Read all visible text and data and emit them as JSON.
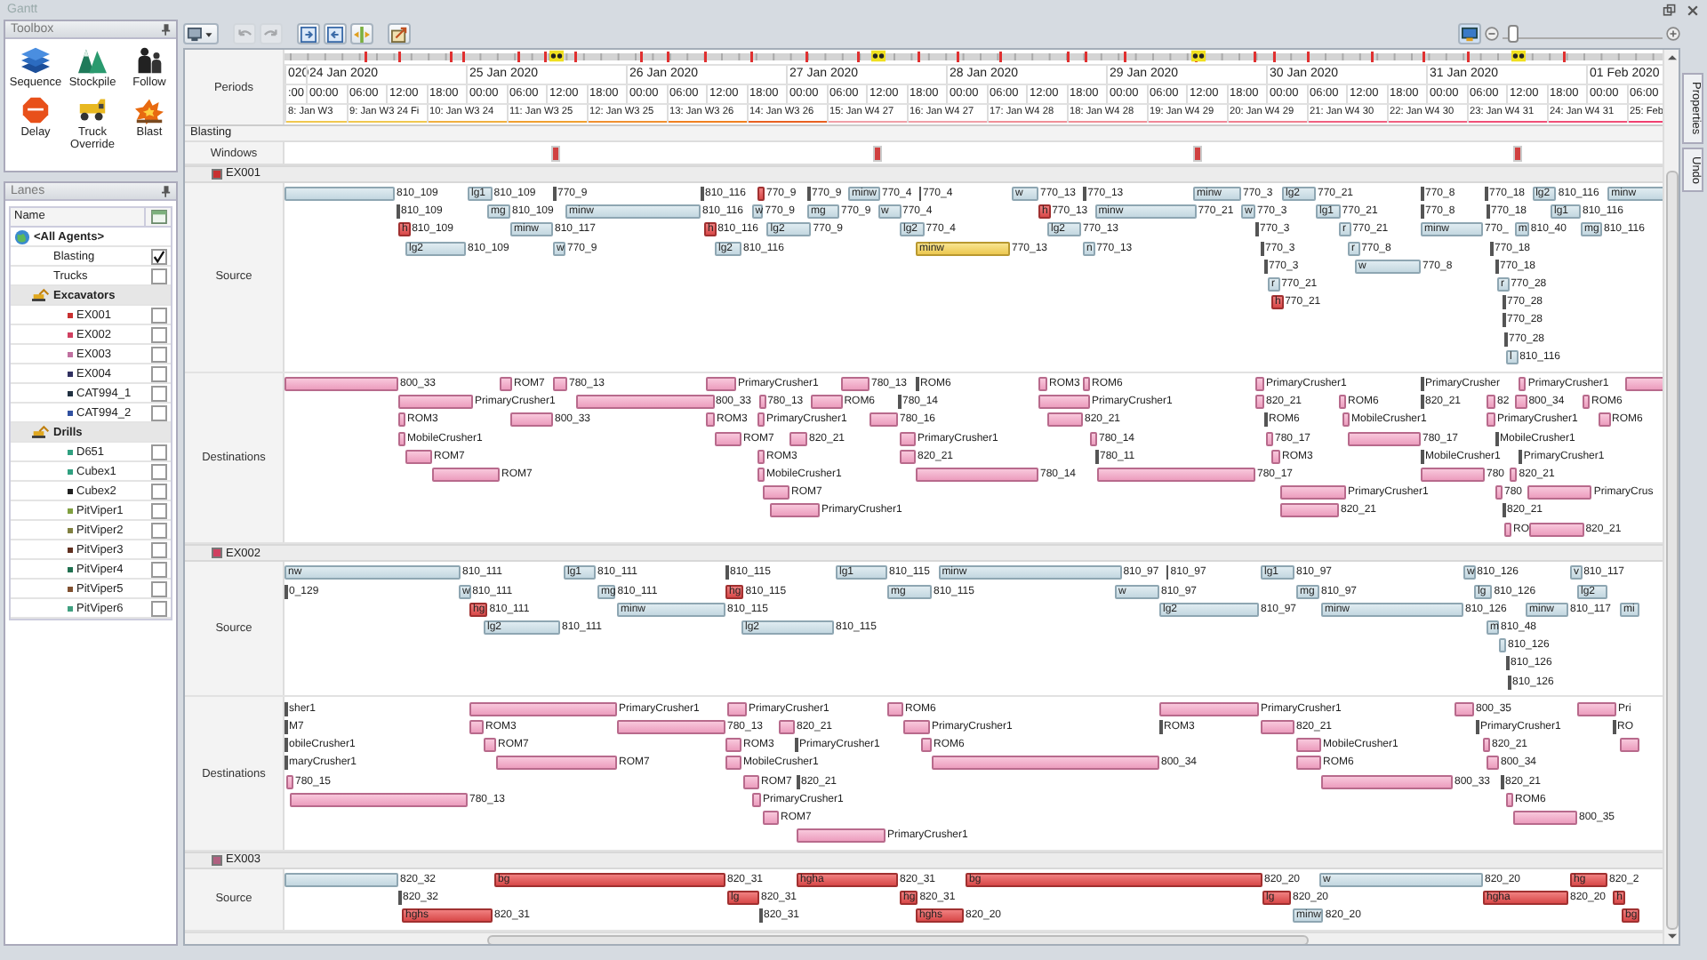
{
  "window": {
    "title": "Gantt"
  },
  "toolbox": {
    "title": "Toolbox",
    "tools": [
      {
        "label": "Sequence",
        "kind": "layers"
      },
      {
        "label": "Stockpile",
        "kind": "stockpile"
      },
      {
        "label": "Follow",
        "kind": "people"
      },
      {
        "label": "Delay",
        "kind": "stop"
      },
      {
        "label": "Truck Override",
        "kind": "truck"
      },
      {
        "label": "Blast",
        "kind": "blast"
      }
    ]
  },
  "lanes": {
    "title": "Lanes",
    "column": "Name",
    "items": [
      {
        "name": "<All Agents>",
        "kind": "root",
        "children": [
          {
            "name": "Blasting",
            "kind": "lane",
            "checked": true
          },
          {
            "name": "Trucks",
            "kind": "lane",
            "checked": false
          },
          {
            "name": "Excavators",
            "kind": "group",
            "children": [
              {
                "name": "EX001",
                "kind": "agent",
                "color": "#c83030",
                "checked": false
              },
              {
                "name": "EX002",
                "kind": "agent",
                "color": "#d04060",
                "checked": false
              },
              {
                "name": "EX003",
                "kind": "agent",
                "color": "#c070a0",
                "checked": false
              },
              {
                "name": "EX004",
                "kind": "agent",
                "color": "#303060",
                "checked": false
              },
              {
                "name": "CAT994_1",
                "kind": "agent",
                "color": "#203040",
                "checked": false
              },
              {
                "name": "CAT994_2",
                "kind": "agent",
                "color": "#3050a0",
                "checked": false
              }
            ]
          },
          {
            "name": "Drills",
            "kind": "group",
            "children": [
              {
                "name": "D651",
                "kind": "agent",
                "color": "#30a080",
                "checked": false
              },
              {
                "name": "Cubex1",
                "kind": "agent",
                "color": "#30a080",
                "checked": false
              },
              {
                "name": "Cubex2",
                "kind": "agent",
                "color": "#202020",
                "checked": false
              },
              {
                "name": "PitViper1",
                "kind": "agent",
                "color": "#80a040",
                "checked": false
              },
              {
                "name": "PitViper2",
                "kind": "agent",
                "color": "#808040",
                "checked": false
              },
              {
                "name": "PitViper3",
                "kind": "agent",
                "color": "#603020",
                "checked": false
              },
              {
                "name": "PitViper4",
                "kind": "agent",
                "color": "#207050",
                "checked": false
              },
              {
                "name": "PitViper5",
                "kind": "agent",
                "color": "#805030",
                "checked": false
              },
              {
                "name": "PitViper6",
                "kind": "agent",
                "color": "#40a080",
                "checked": false
              }
            ]
          }
        ]
      }
    ]
  },
  "toolbar": {
    "buttons": [
      {
        "kind": "view-menu",
        "disabled": false
      },
      {
        "kind": "undo",
        "disabled": true
      },
      {
        "kind": "redo",
        "disabled": true
      },
      {
        "kind": "expand",
        "disabled": false
      },
      {
        "kind": "collapse",
        "disabled": false
      },
      {
        "kind": "fit",
        "disabled": false
      },
      {
        "kind": "export",
        "disabled": false
      }
    ],
    "zoom": {
      "level": 0.03
    }
  },
  "timeline": {
    "label": "Periods",
    "dates": [
      "020",
      "24 Jan 2020",
      "25 Jan 2020",
      "26 Jan 2020",
      "27 Jan 2020",
      "28 Jan 2020",
      "29 Jan 2020",
      "30 Jan 2020",
      "31 Jan 2020",
      "01 Feb 2020"
    ],
    "hours": [
      ":00",
      "00:00",
      "06:00",
      "12:00",
      "18:00",
      "00:00",
      "06:00",
      "12:00",
      "18:00",
      "00:00",
      "06:00",
      "12:00",
      "18:00",
      "00:00",
      "06:00",
      "12:00",
      "18:00",
      "00:00",
      "06:00",
      "12:00",
      "18:00",
      "00:00",
      "06:00",
      "12:00",
      "18:00",
      "00:00",
      "06:00",
      "12:00",
      "18:00",
      "00:00",
      "06:00",
      "12:00",
      "18:00",
      "00:00",
      "06:00"
    ],
    "shifts": [
      {
        "label": "8: Jan W3",
        "color": "#f0c850"
      },
      {
        "label": "9: Jan W3 24 Fi",
        "color": "#f0c850"
      },
      {
        "label": "10: Jan W3 24",
        "color": "#f0b040"
      },
      {
        "label": "11: Jan W3 25",
        "color": "#f0a030"
      },
      {
        "label": "12: Jan W3 25",
        "color": "#f09030"
      },
      {
        "label": "13: Jan W3 26",
        "color": "#f08020"
      },
      {
        "label": "14: Jan W3 26",
        "color": "#e86020"
      },
      {
        "label": "15: Jan W4 27",
        "color": "#f0a0a8"
      },
      {
        "label": "16: Jan W4 27",
        "color": "#f0a0a8"
      },
      {
        "label": "17: Jan W4 28",
        "color": "#f09098"
      },
      {
        "label": "18: Jan W4 28",
        "color": "#f09098"
      },
      {
        "label": "19: Jan W4 29",
        "color": "#f08898"
      },
      {
        "label": "20: Jan W4 29",
        "color": "#f08090"
      },
      {
        "label": "21: Jan W4 30",
        "color": "#f06080"
      },
      {
        "label": "22: Jan W4 30",
        "color": "#f06080"
      },
      {
        "label": "23: Jan W4 31",
        "color": "#f05078"
      },
      {
        "label": "24: Jan W4 31",
        "color": "#f05078"
      },
      {
        "label": "25: Feb",
        "color": "#f04070"
      }
    ]
  },
  "blasting": {
    "title": "Blasting",
    "label": "Windows"
  },
  "groups": [
    {
      "name": "EX001",
      "color": "#c83030",
      "lanes": [
        {
          "label": "Source",
          "rows": [
            {
              "tasks": [
                {
                  "kind": "waste",
                  "label": "810_109"
                },
                {
                  "code": "lg1",
                  "kind": "waste",
                  "label": "810_109"
                },
                {
                  "kind": "tick",
                  "label": "770_9"
                },
                {
                  "kind": "tick",
                  "label": "810_116"
                },
                {
                  "kind": "high",
                  "label": "770_9"
                },
                {
                  "kind": "tick",
                  "label": "770_9"
                },
                {
                  "code": "minw",
                  "kind": "waste",
                  "label": "770_4"
                },
                {
                  "kind": "tick",
                  "label": "770_4"
                },
                {
                  "code": "w",
                  "kind": "waste",
                  "label": "770_13"
                },
                {
                  "kind": "tick",
                  "label": "770_13"
                },
                {
                  "code": "minw",
                  "kind": "waste",
                  "label": "770_3"
                },
                {
                  "code": "lg2",
                  "kind": "waste",
                  "label": "770_21"
                },
                {
                  "kind": "tick",
                  "label": "770_8"
                },
                {
                  "kind": "tick",
                  "label": "770_18"
                },
                {
                  "code": "lg2",
                  "kind": "waste",
                  "label": "810_116"
                },
                {
                  "code": "minw",
                  "kind": "waste"
                }
              ]
            },
            {
              "tasks": [
                {
                  "kind": "tick",
                  "label": "810_109"
                },
                {
                  "code": "mg",
                  "kind": "waste",
                  "label": "810_109"
                },
                {
                  "code": "minw",
                  "kind": "waste",
                  "label": "810_116"
                },
                {
                  "code": "w",
                  "kind": "waste",
                  "label": "770_9"
                },
                {
                  "code": "mg",
                  "kind": "waste",
                  "label": "770_9"
                },
                {
                  "code": "w",
                  "kind": "waste",
                  "label": "770_4"
                },
                {
                  "code": "h",
                  "kind": "high",
                  "label": "770_13"
                },
                {
                  "code": "minw",
                  "kind": "waste",
                  "label": "770_21"
                },
                {
                  "code": "w",
                  "kind": "waste",
                  "label": "770_3"
                },
                {
                  "code": "lg1",
                  "kind": "waste",
                  "label": "770_21"
                },
                {
                  "kind": "tick",
                  "label": "770_8"
                },
                {
                  "kind": "tick",
                  "label": "770_18"
                },
                {
                  "code": "lg1",
                  "kind": "waste",
                  "label": "810_116"
                }
              ]
            },
            {
              "tasks": [
                {
                  "code": "h",
                  "kind": "high",
                  "label": "810_109"
                },
                {
                  "code": "minw",
                  "kind": "waste",
                  "label": "810_117"
                },
                {
                  "code": "h",
                  "kind": "high",
                  "label": "810_116"
                },
                {
                  "code": "lg2",
                  "kind": "waste",
                  "label": "770_9"
                },
                {
                  "code": "lg2",
                  "kind": "waste",
                  "label": "770_4"
                },
                {
                  "code": "lg2",
                  "kind": "waste",
                  "label": "770_13"
                },
                {
                  "kind": "tick",
                  "label": "770_3"
                },
                {
                  "code": "r",
                  "kind": "waste",
                  "label": "770_21"
                },
                {
                  "code": "minw",
                  "kind": "waste",
                  "label": "770_"
                },
                {
                  "code": "m",
                  "kind": "waste",
                  "label": "810_40"
                },
                {
                  "code": "mg",
                  "kind": "waste",
                  "label": "810_116"
                }
              ]
            },
            {
              "tasks": [
                {
                  "code": "lg2",
                  "kind": "waste",
                  "label": "810_109"
                },
                {
                  "code": "w",
                  "kind": "waste",
                  "label": "770_9"
                },
                {
                  "code": "lg2",
                  "kind": "waste",
                  "label": "810_116"
                },
                {
                  "code": "minw",
                  "kind": "flagged",
                  "label": "770_13"
                },
                {
                  "code": "n",
                  "kind": "waste",
                  "label": "770_13"
                },
                {
                  "kind": "tick",
                  "label": "770_3"
                },
                {
                  "code": "r",
                  "kind": "waste",
                  "label": "770_8"
                },
                {
                  "kind": "tick",
                  "label": "770_18"
                }
              ]
            },
            {
              "tasks": [
                {
                  "kind": "tick",
                  "label": "770_3"
                },
                {
                  "code": "w",
                  "kind": "waste",
                  "label": "770_8"
                },
                {
                  "kind": "tick",
                  "label": "770_18"
                }
              ]
            },
            {
              "tasks": [
                {
                  "code": "r",
                  "kind": "waste",
                  "label": "770_21"
                },
                {
                  "code": "r",
                  "kind": "waste",
                  "label": "770_28"
                }
              ]
            },
            {
              "tasks": [
                {
                  "code": "h",
                  "kind": "high",
                  "label": "770_21"
                },
                {
                  "kind": "tick",
                  "label": "770_28"
                }
              ]
            },
            {
              "tasks": [
                {
                  "kind": "tick",
                  "label": "770_28"
                }
              ]
            },
            {
              "tasks": [
                {
                  "kind": "tick",
                  "label": "770_28"
                }
              ]
            },
            {
              "tasks": [
                {
                  "code": "l",
                  "kind": "waste",
                  "label": "810_116"
                }
              ]
            }
          ]
        },
        {
          "label": "Destinations",
          "rows": [
            {
              "tasks": [
                {
                  "kind": "ore",
                  "label": "800_33"
                },
                {
                  "kind": "ore",
                  "label": "ROM7"
                },
                {
                  "kind": "ore",
                  "label": "780_13"
                },
                {
                  "kind": "ore",
                  "label": "PrimaryCrusher1"
                },
                {
                  "kind": "ore",
                  "label": "780_13"
                },
                {
                  "kind": "tick",
                  "label": "ROM6"
                },
                {
                  "kind": "ore",
                  "label": "ROM3"
                },
                {
                  "kind": "ore",
                  "label": "ROM6"
                },
                {
                  "kind": "ore",
                  "label": "PrimaryCrusher1"
                },
                {
                  "kind": "tick",
                  "label": "PrimaryCrusher"
                },
                {
                  "kind": "ore",
                  "label": "PrimaryCrusher1"
                },
                {
                  "kind": "ore"
                }
              ]
            },
            {
              "tasks": [
                {
                  "kind": "ore",
                  "label": "PrimaryCrusher1"
                },
                {
                  "kind": "ore",
                  "label": "800_33"
                },
                {
                  "kind": "ore",
                  "label": "780_13"
                },
                {
                  "kind": "ore",
                  "label": "ROM6"
                },
                {
                  "kind": "tick",
                  "label": "780_14"
                },
                {
                  "kind": "ore",
                  "label": "PrimaryCrusher1"
                },
                {
                  "kind": "ore",
                  "label": "820_21"
                },
                {
                  "kind": "ore",
                  "label": "ROM6"
                },
                {
                  "kind": "tick",
                  "label": "820_21"
                },
                {
                  "kind": "ore",
                  "label": "82"
                },
                {
                  "kind": "ore",
                  "label": "800_34"
                },
                {
                  "kind": "ore",
                  "label": "ROM6"
                }
              ]
            },
            {
              "tasks": [
                {
                  "kind": "ore",
                  "label": "ROM3"
                },
                {
                  "kind": "ore",
                  "label": "800_33"
                },
                {
                  "kind": "ore",
                  "label": "ROM3"
                },
                {
                  "kind": "ore",
                  "label": "PrimaryCrusher1"
                },
                {
                  "kind": "ore",
                  "label": "780_16"
                },
                {
                  "kind": "ore",
                  "label": "820_21"
                },
                {
                  "kind": "tick",
                  "label": "ROM6"
                },
                {
                  "kind": "ore",
                  "label": "MobileCrusher1"
                },
                {
                  "kind": "ore",
                  "label": "PrimaryCrusher1"
                },
                {
                  "kind": "ore",
                  "label": "ROM6"
                }
              ]
            },
            {
              "tasks": [
                {
                  "kind": "ore",
                  "label": "MobileCrusher1"
                },
                {
                  "kind": "ore",
                  "label": "ROM7"
                },
                {
                  "kind": "ore",
                  "label": "820_21"
                },
                {
                  "kind": "ore",
                  "label": "PrimaryCrusher1"
                },
                {
                  "kind": "ore",
                  "label": "780_14"
                },
                {
                  "kind": "ore",
                  "label": "780_17"
                },
                {
                  "kind": "ore",
                  "label": "780_17"
                },
                {
                  "kind": "tick",
                  "label": "MobileCrusher1"
                }
              ]
            },
            {
              "tasks": [
                {
                  "kind": "ore",
                  "label": "ROM7"
                },
                {
                  "kind": "ore",
                  "label": "ROM3"
                },
                {
                  "kind": "ore",
                  "label": "820_21"
                },
                {
                  "kind": "tick",
                  "label": "780_11"
                },
                {
                  "kind": "ore",
                  "label": "ROM3"
                },
                {
                  "kind": "tick",
                  "label": "MobileCrusher1"
                },
                {
                  "kind": "tick",
                  "label": "PrimaryCrusher1"
                }
              ]
            },
            {
              "tasks": [
                {
                  "kind": "ore",
                  "label": "ROM7"
                },
                {
                  "kind": "ore",
                  "label": "MobileCrusher1"
                },
                {
                  "kind": "ore",
                  "label": "780_14"
                },
                {
                  "kind": "ore",
                  "label": "780_17"
                },
                {
                  "kind": "ore",
                  "label": "780"
                },
                {
                  "kind": "ore",
                  "label": "820_21"
                }
              ]
            },
            {
              "tasks": [
                {
                  "kind": "ore",
                  "label": "ROM7"
                },
                {
                  "kind": "ore",
                  "label": "PrimaryCrusher1"
                },
                {
                  "kind": "ore",
                  "label": "780"
                },
                {
                  "kind": "ore",
                  "label": "PrimaryCrus"
                }
              ]
            },
            {
              "tasks": [
                {
                  "kind": "ore",
                  "label": "PrimaryCrusher1"
                },
                {
                  "kind": "ore",
                  "label": "820_21"
                },
                {
                  "kind": "tick",
                  "label": "820_21"
                }
              ]
            },
            {
              "tasks": [
                {
                  "kind": "ore",
                  "label": "RO"
                },
                {
                  "kind": "ore",
                  "label": "820_21"
                }
              ]
            }
          ]
        }
      ]
    },
    {
      "name": "EX002",
      "color": "#d04060",
      "lanes": [
        {
          "label": "Source",
          "rows": [
            {
              "tasks": [
                {
                  "code": "nw",
                  "kind": "waste",
                  "label": "810_111"
                },
                {
                  "code": "lg1",
                  "kind": "waste",
                  "label": "810_111"
                },
                {
                  "kind": "tick",
                  "label": "810_115"
                },
                {
                  "code": "lg1",
                  "kind": "waste",
                  "label": "810_115"
                },
                {
                  "code": "minw",
                  "kind": "waste",
                  "label": "810_97"
                },
                {
                  "kind": "tick",
                  "label": "810_97"
                },
                {
                  "code": "lg1",
                  "kind": "waste",
                  "label": "810_97"
                },
                {
                  "code": "w",
                  "kind": "waste",
                  "label": "810_126"
                },
                {
                  "code": "v",
                  "kind": "waste",
                  "label": "810_117"
                }
              ]
            },
            {
              "tasks": [
                {
                  "kind": "tick",
                  "label": "0_129"
                },
                {
                  "code": "w",
                  "kind": "waste",
                  "label": "810_111"
                },
                {
                  "code": "mg",
                  "kind": "waste",
                  "label": "810_111"
                },
                {
                  "code": "hg",
                  "kind": "high",
                  "label": "810_115"
                },
                {
                  "code": "mg",
                  "kind": "waste",
                  "label": "810_115"
                },
                {
                  "code": "w",
                  "kind": "waste",
                  "label": "810_97"
                },
                {
                  "code": "mg",
                  "kind": "waste",
                  "label": "810_97"
                },
                {
                  "code": "lg",
                  "kind": "waste",
                  "label": "810_126"
                },
                {
                  "code": "lg2",
                  "kind": "waste"
                }
              ]
            },
            {
              "tasks": [
                {
                  "code": "hg",
                  "kind": "high",
                  "label": "810_111"
                },
                {
                  "code": "minw",
                  "kind": "waste",
                  "label": "810_115"
                },
                {
                  "code": "lg2",
                  "kind": "waste",
                  "label": "810_97"
                },
                {
                  "code": "minw",
                  "kind": "waste",
                  "label": "810_126"
                },
                {
                  "code": "minw",
                  "kind": "waste",
                  "label": "810_117"
                },
                {
                  "code": "mi",
                  "kind": "waste"
                }
              ]
            },
            {
              "tasks": [
                {
                  "code": "lg2",
                  "kind": "waste",
                  "label": "810_111"
                },
                {
                  "code": "lg2",
                  "kind": "waste",
                  "label": "810_115"
                },
                {
                  "code": "m",
                  "kind": "waste",
                  "label": "810_48"
                }
              ]
            },
            {
              "tasks": [
                {
                  "kind": "waste",
                  "label": "810_126"
                }
              ]
            },
            {
              "tasks": [
                {
                  "kind": "tick",
                  "label": "810_126"
                }
              ]
            },
            {
              "tasks": [
                {
                  "kind": "tick",
                  "label": "810_126"
                }
              ]
            }
          ]
        },
        {
          "label": "Destinations",
          "rows": [
            {
              "tasks": [
                {
                  "kind": "tick",
                  "label": "sher1"
                },
                {
                  "kind": "ore",
                  "label": "PrimaryCrusher1"
                },
                {
                  "kind": "ore",
                  "label": "PrimaryCrusher1"
                },
                {
                  "kind": "ore",
                  "label": "ROM6"
                },
                {
                  "kind": "ore",
                  "label": "PrimaryCrusher1"
                },
                {
                  "kind": "ore",
                  "label": "800_35"
                },
                {
                  "kind": "ore",
                  "label": "Pri"
                }
              ]
            },
            {
              "tasks": [
                {
                  "kind": "tick",
                  "label": "M7"
                },
                {
                  "kind": "ore",
                  "label": "ROM3"
                },
                {
                  "kind": "ore",
                  "label": "780_13"
                },
                {
                  "kind": "ore",
                  "label": "820_21"
                },
                {
                  "kind": "ore",
                  "label": "PrimaryCrusher1"
                },
                {
                  "kind": "tick",
                  "label": "ROM3"
                },
                {
                  "kind": "ore",
                  "label": "820_21"
                },
                {
                  "kind": "tick",
                  "label": "PrimaryCrusher1"
                },
                {
                  "kind": "tick",
                  "label": "RO"
                }
              ]
            },
            {
              "tasks": [
                {
                  "kind": "tick",
                  "label": "obileCrusher1"
                },
                {
                  "kind": "ore",
                  "label": "ROM7"
                },
                {
                  "kind": "ore",
                  "label": "ROM3"
                },
                {
                  "kind": "tick",
                  "label": "PrimaryCrusher1"
                },
                {
                  "kind": "ore",
                  "label": "ROM6"
                },
                {
                  "kind": "ore",
                  "label": "MobileCrusher1"
                },
                {
                  "kind": "ore",
                  "label": "820_21"
                },
                {
                  "kind": "ore"
                }
              ]
            },
            {
              "tasks": [
                {
                  "kind": "tick",
                  "label": "maryCrusher1"
                },
                {
                  "kind": "ore",
                  "label": "ROM7"
                },
                {
                  "kind": "ore",
                  "label": "MobileCrusher1"
                },
                {
                  "kind": "ore",
                  "label": "800_34"
                },
                {
                  "kind": "ore",
                  "label": "ROM6"
                },
                {
                  "kind": "ore",
                  "label": "800_34"
                }
              ]
            },
            {
              "tasks": [
                {
                  "kind": "ore",
                  "label": "780_15"
                },
                {
                  "kind": "ore",
                  "label": "ROM7"
                },
                {
                  "kind": "tick",
                  "label": "820_21"
                },
                {
                  "kind": "ore",
                  "label": "800_33"
                },
                {
                  "kind": "tick",
                  "label": "820_21"
                }
              ]
            },
            {
              "tasks": [
                {
                  "kind": "ore",
                  "label": "780_13"
                },
                {
                  "kind": "ore",
                  "label": "PrimaryCrusher1"
                },
                {
                  "kind": "ore",
                  "label": "ROM6"
                }
              ]
            },
            {
              "tasks": [
                {
                  "kind": "ore",
                  "label": "ROM7"
                },
                {
                  "kind": "ore",
                  "label": "800_35"
                }
              ]
            },
            {
              "tasks": [
                {
                  "kind": "ore",
                  "label": "PrimaryCrusher1"
                }
              ]
            }
          ]
        }
      ]
    },
    {
      "name": "EX003",
      "color": "#b06080",
      "lanes": [
        {
          "label": "Source",
          "rows": [
            {
              "tasks": [
                {
                  "kind": "waste",
                  "label": "820_32"
                },
                {
                  "code": "bg",
                  "kind": "high",
                  "label": "820_31"
                },
                {
                  "code": "hgha",
                  "kind": "high",
                  "label": "820_31"
                },
                {
                  "code": "bg",
                  "kind": "high",
                  "label": "820_20"
                },
                {
                  "code": "w",
                  "kind": "waste",
                  "label": "820_20"
                },
                {
                  "code": "hg",
                  "kind": "high",
                  "label": "820_2"
                }
              ]
            },
            {
              "tasks": [
                {
                  "kind": "tick",
                  "label": "820_32"
                },
                {
                  "code": "lg",
                  "kind": "high",
                  "label": "820_31"
                },
                {
                  "code": "hg",
                  "kind": "high",
                  "label": "820_31"
                },
                {
                  "code": "lg",
                  "kind": "high",
                  "label": "820_20"
                },
                {
                  "code": "hgha",
                  "kind": "high",
                  "label": "820_20"
                },
                {
                  "code": "h",
                  "kind": "high"
                }
              ]
            },
            {
              "tasks": [
                {
                  "code": "hghs",
                  "kind": "high",
                  "label": "820_31"
                },
                {
                  "kind": "tick",
                  "label": "820_31"
                },
                {
                  "code": "hghs",
                  "kind": "high",
                  "label": "820_20"
                },
                {
                  "code": "minw",
                  "kind": "waste",
                  "label": "820_20"
                },
                {
                  "code": "bg",
                  "kind": "high"
                }
              ]
            }
          ]
        }
      ]
    }
  ],
  "side_tabs": [
    "Properties",
    "Undo"
  ]
}
